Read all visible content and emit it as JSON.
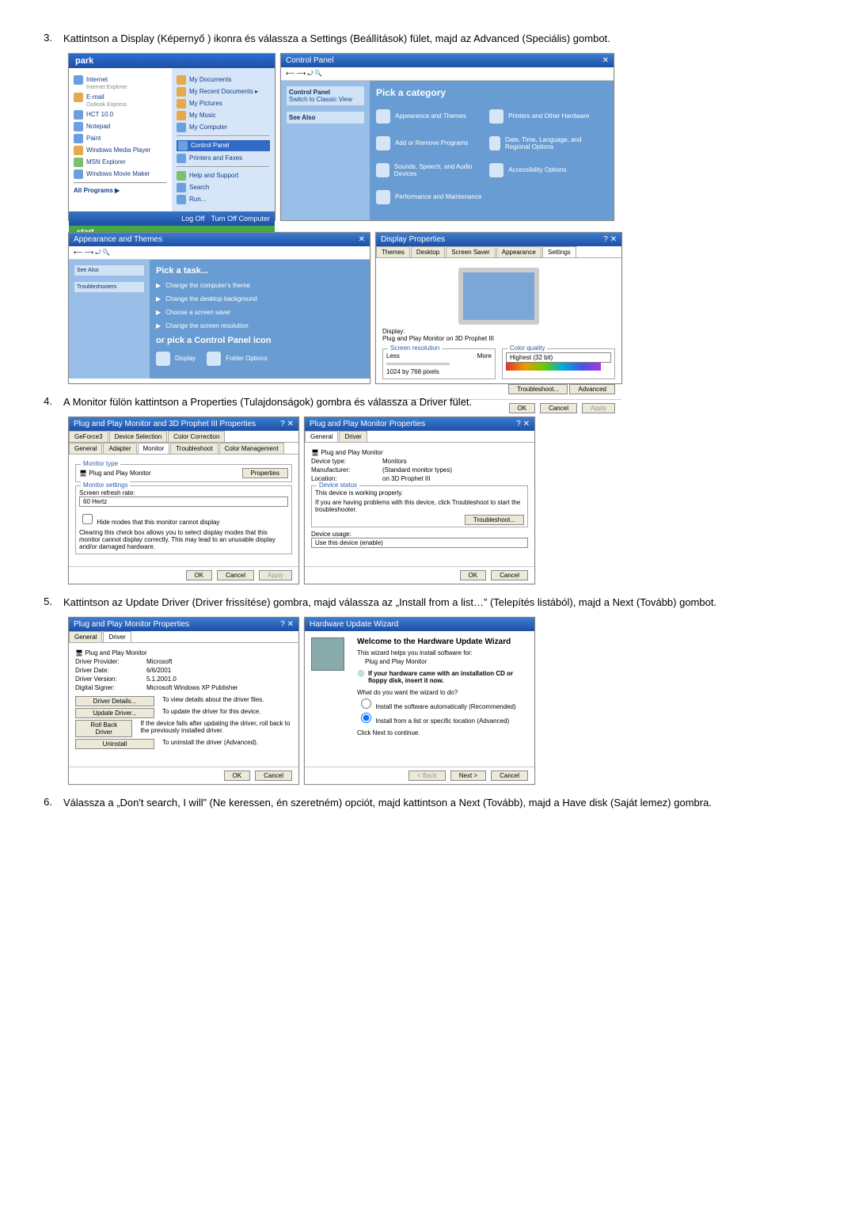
{
  "steps": {
    "s3": "Kattintson a Display (Képernyő ) ikonra és válassza a Settings (Beállítások) fület, majd az Advanced (Speciális) gombot.",
    "s4": "A Monitor fülön kattintson a Properties (Tulajdonságok) gombra és válassza a Driver fület.",
    "s5": "Kattintson az Update Driver (Driver frissítése) gombra, majd válassza az „Install from a list…” (Telepítés listából), majd a Next (Tovább) gombot.",
    "s6": "Válassza a „Don't search, I will” (Ne keressen, én szeretném) opciót, majd kattintson a Next (Tovább), majd a Have disk (Saját lemez) gombra."
  },
  "nums": {
    "n3": "3.",
    "n4": "4.",
    "n5": "5.",
    "n6": "6."
  },
  "fig1": {
    "start_title": "park",
    "left_items": [
      "Internet",
      "Internet Explorer",
      "E-mail",
      "Outlook Express",
      "HCT 10.0",
      "Notepad",
      "Paint",
      "Windows Media Player",
      "MSN Explorer",
      "Windows Movie Maker"
    ],
    "right_items": [
      "My Documents",
      "My Recent Documents  ▸",
      "My Pictures",
      "My Music",
      "My Computer",
      "Control Panel",
      "Printers and Faxes",
      "Help and Support",
      "Search",
      "Run..."
    ],
    "all_programs": "All Programs  ▶",
    "bottom_logoff": "Log Off",
    "bottom_turnoff": "Turn Off Computer",
    "start": "start",
    "cp_title": "Control Panel",
    "cp_side_title": "Control Panel",
    "cp_side_link": "Switch to Classic View",
    "pick": "Pick a category",
    "see_also": "See Also",
    "cats": [
      "Appearance and Themes",
      "Printers and Other Hardware",
      "Add or Remove Programs",
      "Date, Time, Language, and Regional Options",
      "Sounds, Speech, and Audio Devices",
      "Accessibility Options",
      "Performance and Maintenance"
    ]
  },
  "fig2": {
    "left_title": "Appearance and Themes",
    "pick_task": "Pick a task...",
    "tasks": [
      "Change the computer's theme",
      "Change the desktop background",
      "Choose a screen saver",
      "Change the screen resolution"
    ],
    "or_pick": "or pick a Control Panel icon",
    "icons": [
      "Display",
      "Folder Options"
    ],
    "dp_title": "Display Properties",
    "tabs": [
      "Themes",
      "Desktop",
      "Screen Saver",
      "Appearance",
      "Settings"
    ],
    "display_label": "Display:",
    "display_val": "Plug and Play Monitor on 3D Prophet III",
    "res_label": "Screen resolution",
    "less": "Less",
    "more": "More",
    "res_val": "1024 by 768 pixels",
    "cq_label": "Color quality",
    "cq_val": "Highest (32 bit)",
    "troubleshoot": "Troubleshoot...",
    "advanced": "Advanced",
    "ok": "OK",
    "cancel": "Cancel",
    "apply": "Apply"
  },
  "fig3": {
    "left_title": "Plug and Play Monitor and 3D Prophet III Properties",
    "left_tabs_row1": [
      "GeForce3",
      "Device Selection",
      "Color Correction"
    ],
    "left_tabs_row2": [
      "General",
      "Adapter",
      "Monitor",
      "Troubleshoot",
      "Color Management"
    ],
    "mt": "Monitor type",
    "mt_val": "Plug and Play Monitor",
    "props": "Properties",
    "ms": "Monitor settings",
    "srr": "Screen refresh rate:",
    "hz": "60 Hertz",
    "hide": "Hide modes that this monitor cannot display",
    "hide_desc": "Clearing this check box allows you to select display modes that this monitor cannot display correctly. This may lead to an unusable display and/or damaged hardware.",
    "ok": "OK",
    "cancel": "Cancel",
    "apply": "Apply",
    "right_title": "Plug and Play Monitor Properties",
    "right_tabs": [
      "General",
      "Driver"
    ],
    "right_name": "Plug and Play Monitor",
    "dtype_k": "Device type:",
    "dtype_v": "Monitors",
    "manu_k": "Manufacturer:",
    "manu_v": "(Standard monitor types)",
    "loc_k": "Location:",
    "loc_v": "on 3D Prophet III",
    "ds": "Device status",
    "ds_1": "This device is working properly.",
    "ds_2": "If you are having problems with this device, click Troubleshoot to start the troubleshooter.",
    "ts": "Troubleshoot...",
    "du": "Device usage:",
    "du_v": "Use this device (enable)"
  },
  "fig4": {
    "left_title": "Plug and Play Monitor Properties",
    "tabs": [
      "General",
      "Driver"
    ],
    "name": "Plug and Play Monitor",
    "dp_k": "Driver Provider:",
    "dp_v": "Microsoft",
    "dd_k": "Driver Date:",
    "dd_v": "6/6/2001",
    "dv_k": "Driver Version:",
    "dv_v": "5.1.2001.0",
    "ds_k": "Digital Signer:",
    "ds_v": "Microsoft Windows XP Publisher",
    "b1": "Driver Details...",
    "b1d": "To view details about the driver files.",
    "b2": "Update Driver...",
    "b2d": "To update the driver for this device.",
    "b3": "Roll Back Driver",
    "b3d": "If the device fails after updating the driver, roll back to the previously installed driver.",
    "b4": "Uninstall",
    "b4d": "To uninstall the driver (Advanced).",
    "ok": "OK",
    "cancel": "Cancel",
    "wiz_title": "Hardware Update Wizard",
    "wiz_h1": "Welcome to the Hardware Update Wizard",
    "wiz_l1": "This wizard helps you install software for:",
    "wiz_dev": "Plug and Play Monitor",
    "wiz_cd": "If your hardware came with an installation CD or floppy disk, insert it now.",
    "wiz_q": "What do you want the wizard to do?",
    "wiz_o1": "Install the software automatically (Recommended)",
    "wiz_o2": "Install from a list or specific location (Advanced)",
    "wiz_next_hint": "Click Next to continue.",
    "back": "< Back",
    "next": "Next >",
    "cancel2": "Cancel"
  }
}
